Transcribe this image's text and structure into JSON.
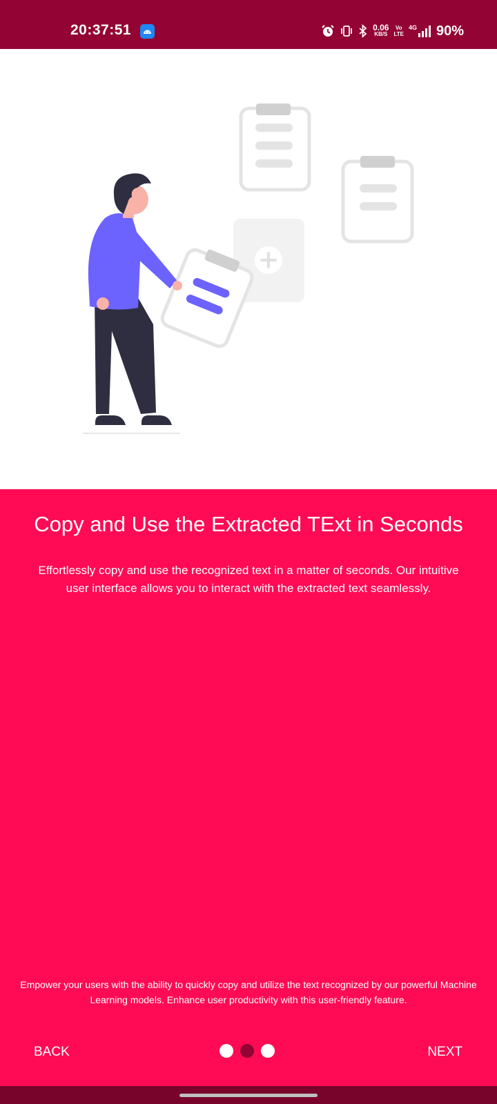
{
  "status_bar": {
    "time": "20:37:51",
    "speed_value": "0.06",
    "speed_unit": "KB/S",
    "volte_top": "Vo",
    "volte_bottom": "LTE",
    "network": "4G",
    "battery": "90%",
    "icons": [
      "android-debug-icon",
      "alarm-icon",
      "vibrate-icon",
      "bluetooth-icon",
      "signal-icon"
    ]
  },
  "onboarding": {
    "title": "Copy and Use the Extracted TExt in Seconds",
    "description": "Effortlessly copy and use the recognized text in a matter of seconds. Our intuitive user interface allows you to interact with the extracted text seamlessly.",
    "footer": "Empower your users with the ability to quickly copy and utilize the text recognized by our powerful Machine Learning models. Enhance user productivity with this user-friendly feature."
  },
  "navigation": {
    "back_label": "BACK",
    "next_label": "NEXT",
    "page_count": 3,
    "current_page": 2
  },
  "colors": {
    "background": "#ff0b55",
    "status_bar": "#930333",
    "active_dot": "#930333",
    "inactive_dot": "#ffffff",
    "accent_illustration": "#6c63ff"
  }
}
